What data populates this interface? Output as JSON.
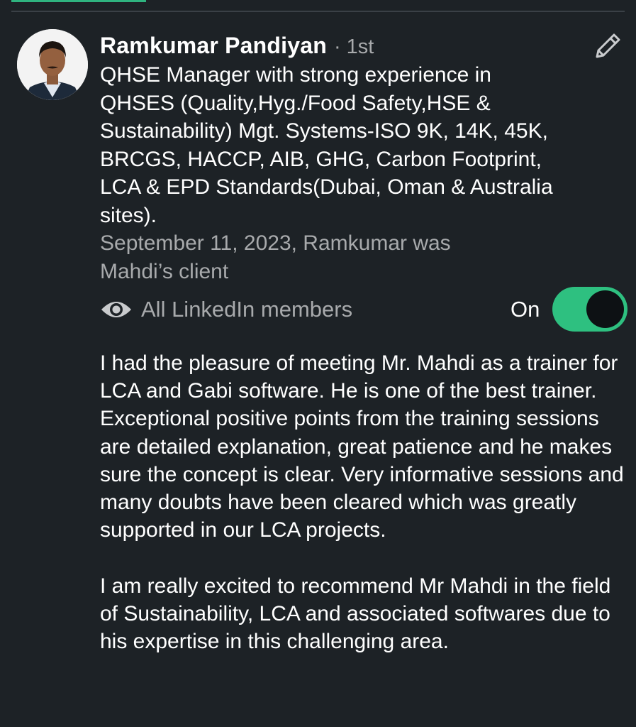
{
  "recommendation": {
    "author": {
      "name": "Ramkumar Pandiyan",
      "degree": "· 1st",
      "headline": "QHSE Manager with strong experience in QHSES (Quality,Hyg./Food Safety,HSE & Sustainability) Mgt. Systems-ISO 9K, 14K, 45K, BRCGS, HACCP, AIB, GHG, Carbon Footprint, LCA & EPD Standards(Dubai, Oman & Australia sites)."
    },
    "meta": "September 11, 2023, Ramkumar was Mahdi’s client",
    "visibility": {
      "icon": "eye-icon",
      "label": "All LinkedIn members",
      "state_label": "On",
      "enabled": true
    },
    "body": [
      "I had the pleasure of meeting Mr. Mahdi as a trainer for LCA and Gabi software. He is one of the best trainer. Exceptional positive points from the training sessions are detailed explanation, great patience and he makes sure the concept is clear. Very informative sessions and many doubts have been cleared which was greatly supported in our LCA projects.",
      "I am really excited to recommend Mr Mahdi in the field of Sustainability, LCA and associated softwares due to his expertise in this challenging area."
    ]
  },
  "icons": {
    "edit": "pencil-icon",
    "visibility": "eye-icon"
  },
  "colors": {
    "background": "#1d2226",
    "accent": "#2ec080",
    "secondary_text": "#a8aaac",
    "primary_text": "#ffffff"
  }
}
